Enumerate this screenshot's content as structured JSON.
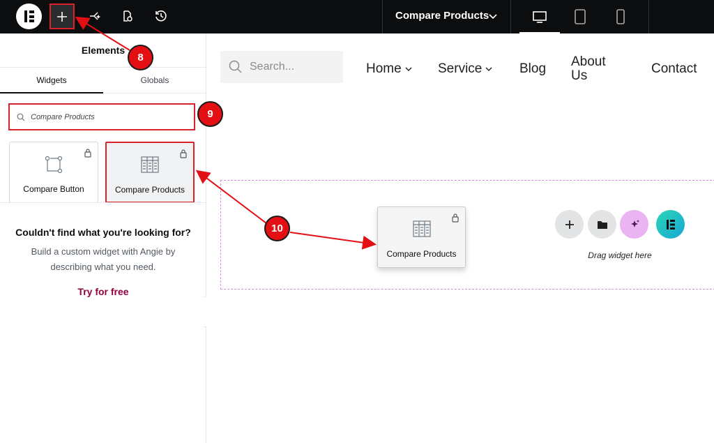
{
  "topbar": {
    "document_title": "Compare Products",
    "icons": [
      "elementor-logo",
      "add-icon",
      "site-settings-icon",
      "page-settings-icon",
      "history-icon",
      "chevron-down-icon",
      "desktop-icon",
      "tablet-icon",
      "mobile-icon"
    ],
    "active_device": "desktop"
  },
  "panel": {
    "title": "Elements",
    "tabs": [
      {
        "label": "Widgets",
        "active": true
      },
      {
        "label": "Globals",
        "active": false
      }
    ],
    "search_value": "Compare Products",
    "widgets": [
      {
        "label": "Compare Button",
        "locked": true
      },
      {
        "label": "Compare Products",
        "locked": true,
        "selected": true
      }
    ],
    "not_found_title": "Couldn't find what you're looking for?",
    "not_found_desc": "Build a custom widget with Angie by describing what you need.",
    "not_found_link": "Try for free"
  },
  "canvas": {
    "search_placeholder": "Search...",
    "nav": [
      {
        "label": "Home",
        "has_dropdown": true
      },
      {
        "label": "Service",
        "has_dropdown": true
      },
      {
        "label": "Blog",
        "has_dropdown": false
      },
      {
        "label": "About Us",
        "has_dropdown": false
      },
      {
        "label": "Contact",
        "has_dropdown": false
      }
    ],
    "dragged_widget": "Compare Products",
    "drop_hint": "Drag widget here"
  },
  "annotations": [
    "8",
    "9",
    "10"
  ],
  "colors": {
    "annotation_red": "#e30f13",
    "outline_red": "#d9222a",
    "link_purple": "#93003f",
    "dropzone_pink": "#d48ae0"
  }
}
